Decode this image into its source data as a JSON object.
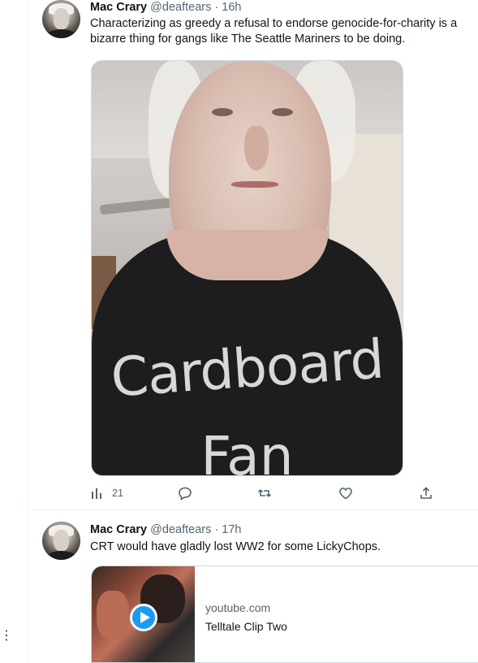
{
  "rail": {
    "more_glyph": "⋮"
  },
  "tweets": [
    {
      "name": "Mac Crary",
      "handle": "@deaftears",
      "separator": "·",
      "time": "16h",
      "text": "Characterizing as greedy a refusal to endorse genocide-for-charity is a bizarre thing for gangs like The Seattle Mariners to be doing.",
      "media": {
        "shirt_line1": "Cardboard",
        "shirt_line2": "Fan"
      },
      "actions": {
        "views_count": "21",
        "reply_count": "",
        "retweet_count": "",
        "like_count": ""
      }
    },
    {
      "name": "Mac Crary",
      "handle": "@deaftears",
      "separator": "·",
      "time": "17h",
      "text": "CRT would have gladly lost WW2 for some LickyChops.",
      "card": {
        "domain": "youtube.com",
        "title": "Telltale Clip Two"
      }
    }
  ],
  "colors": {
    "accent": "#1d9bf0",
    "secondary_text": "#536471",
    "primary_text": "#0f1419",
    "border": "#cfd9de"
  }
}
